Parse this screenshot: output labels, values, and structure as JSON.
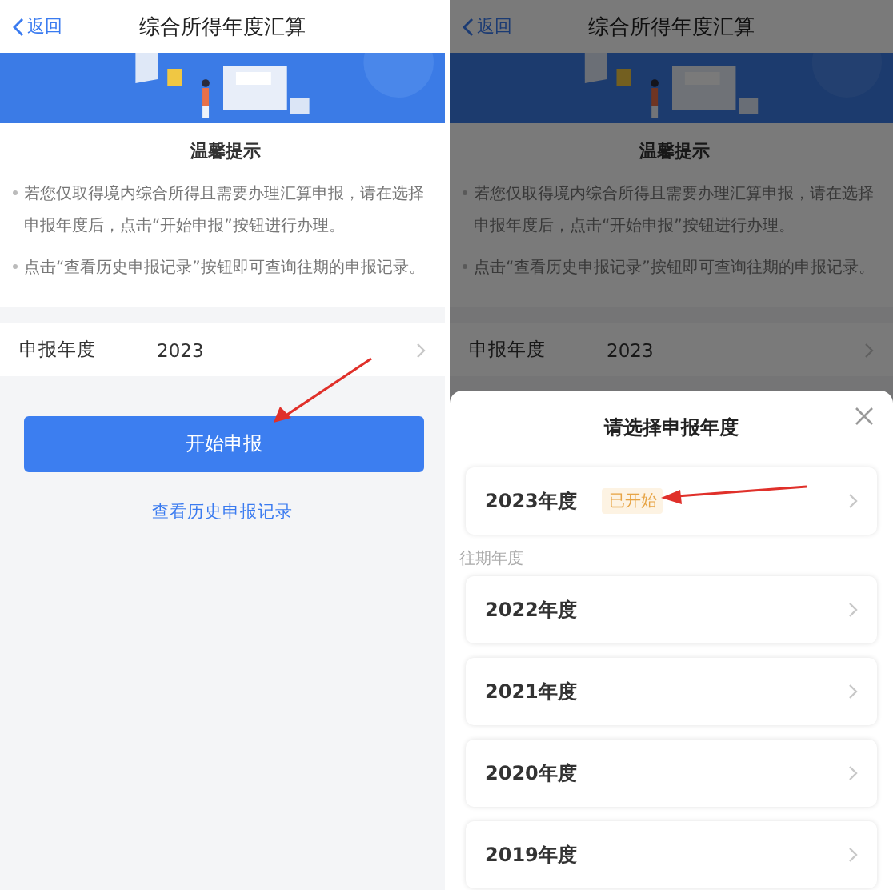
{
  "screens": [
    {
      "dimmed": false,
      "nav": {
        "back": "返回",
        "title": "综合所得年度汇算"
      },
      "tips": {
        "title": "温馨提示",
        "items": [
          "若您仅取得境内综合所得且需要办理汇算申报，请在选择申报年度后，点击“开始申报”按钮进行办理。",
          "点击“查看历史申报记录”按钮即可查询往期的申报记录。"
        ]
      },
      "year_field": {
        "label": "申报年度",
        "value": "2023"
      },
      "start_button": "开始申报",
      "history_link": "查看历史申报记录"
    },
    {
      "dimmed": true,
      "nav": {
        "back": "返回",
        "title": "综合所得年度汇算"
      },
      "tips": {
        "title": "温馨提示",
        "items": [
          "若您仅取得境内综合所得且需要办理汇算申报，请在选择申报年度后，点击“开始申报”按钮进行办理。",
          "点击“查看历史申报记录”按钮即可查询往期的申报记录。"
        ]
      },
      "year_field": {
        "label": "申报年度",
        "value": "2023"
      },
      "sheet": {
        "title": "请选择申报年度",
        "current": {
          "label": "2023年度",
          "badge": "已开始"
        },
        "section": "往期年度",
        "past": [
          {
            "label": "2022年度"
          },
          {
            "label": "2021年度"
          },
          {
            "label": "2020年度"
          },
          {
            "label": "2019年度"
          }
        ]
      }
    }
  ]
}
